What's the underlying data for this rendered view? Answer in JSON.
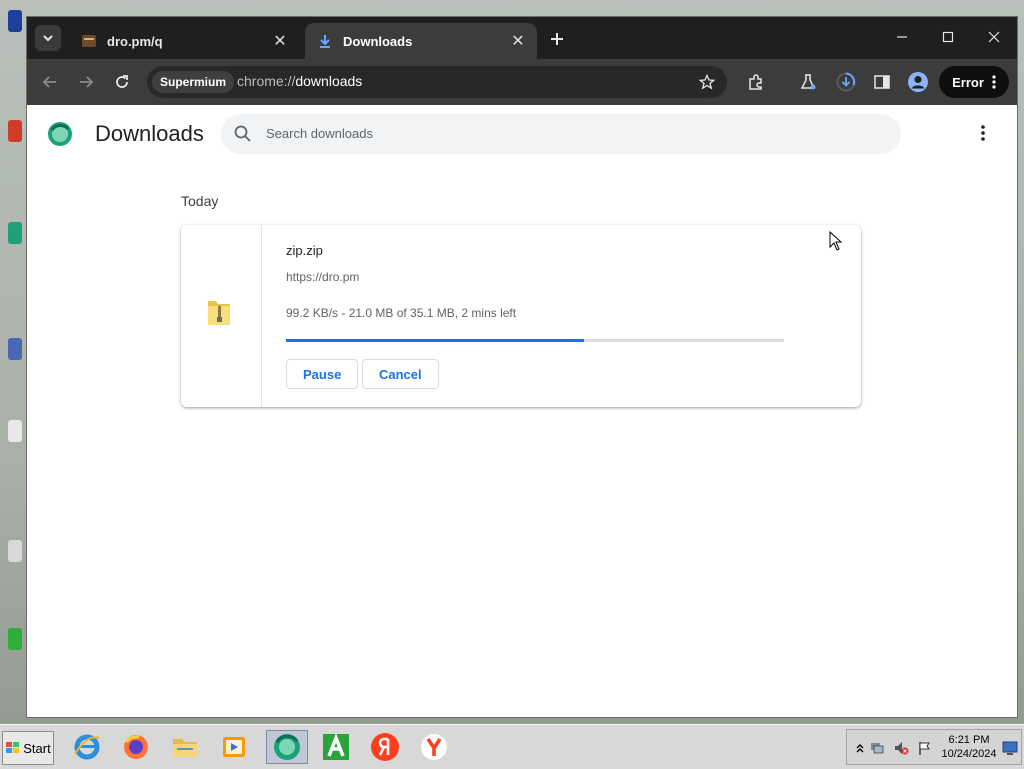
{
  "browser": {
    "tabs": [
      {
        "title": "dro.pm/q",
        "active": false
      },
      {
        "title": "Downloads",
        "active": true
      }
    ],
    "omnibox": {
      "chip": "Supermium",
      "url_scheme": "chrome://",
      "url_host": "downloads"
    },
    "error_button": "Error"
  },
  "page": {
    "title": "Downloads",
    "search_placeholder": "Search downloads",
    "section_label": "Today",
    "download": {
      "filename": "zip.zip",
      "url": "https://dro.pm",
      "status": "99.2 KB/s - 21.0 MB of 35.1 MB, 2 mins left",
      "progress_percent": 59.8,
      "pause_label": "Pause",
      "cancel_label": "Cancel"
    }
  },
  "taskbar": {
    "start_label": "Start",
    "clock_time": "6:21 PM",
    "clock_date": "10/24/2024"
  },
  "colors": {
    "accent": "#1a73e8",
    "titlebar": "#1f1f1f",
    "toolbar": "#3c3c3c"
  }
}
